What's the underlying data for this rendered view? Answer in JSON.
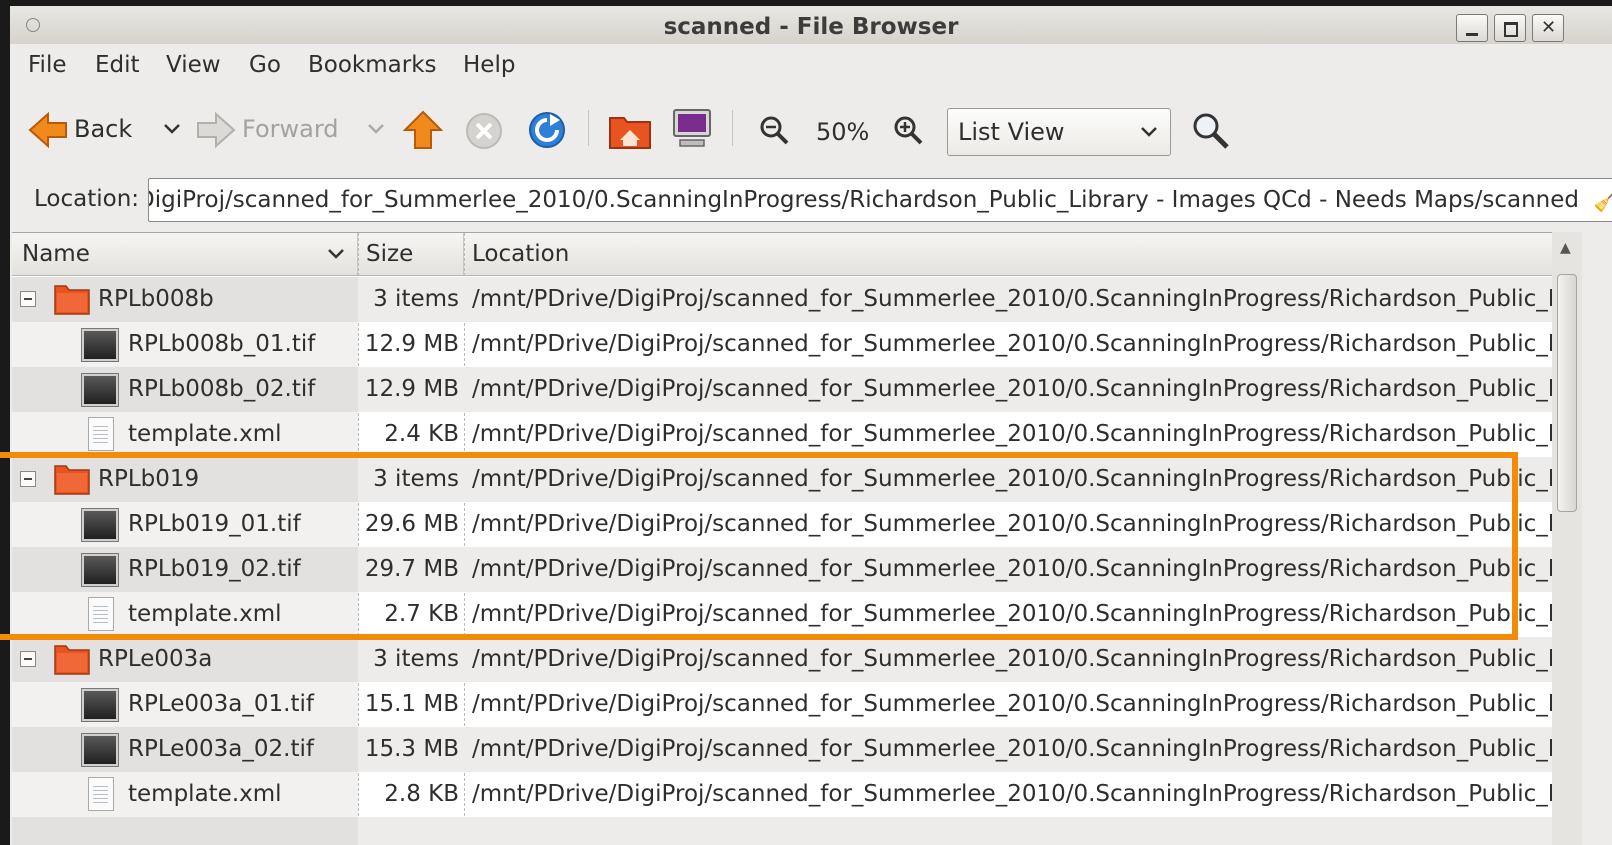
{
  "window": {
    "title": "scanned - File Browser"
  },
  "menu": [
    "File",
    "Edit",
    "View",
    "Go",
    "Bookmarks",
    "Help"
  ],
  "toolbar": {
    "back_label": "Back",
    "forward_label": "Forward",
    "zoom_level": "50%",
    "view_mode": "List View"
  },
  "location": {
    "label": "Location:",
    "path": "/mnt/PDrive/DigiProj/scanned_for_Summerlee_2010/0.ScanningInProgress/Richardson_Public_Library - Images QCd - Needs Maps/scanned"
  },
  "columns": {
    "name": "Name",
    "size": "Size",
    "location": "Location"
  },
  "rows": [
    {
      "type": "folder",
      "name": "RPLb008b",
      "size": "3 items",
      "location": "/mnt/PDrive/DigiProj/scanned_for_Summerlee_2010/0.ScanningInProgress/Richardson_Public_Library"
    },
    {
      "type": "tif",
      "name": "RPLb008b_01.tif",
      "size": "12.9 MB",
      "location": "/mnt/PDrive/DigiProj/scanned_for_Summerlee_2010/0.ScanningInProgress/Richardson_Public_Library"
    },
    {
      "type": "tif",
      "name": "RPLb008b_02.tif",
      "size": "12.9 MB",
      "location": "/mnt/PDrive/DigiProj/scanned_for_Summerlee_2010/0.ScanningInProgress/Richardson_Public_Library"
    },
    {
      "type": "xml",
      "name": "template.xml",
      "size": "2.4 KB",
      "location": "/mnt/PDrive/DigiProj/scanned_for_Summerlee_2010/0.ScanningInProgress/Richardson_Public_Library"
    },
    {
      "type": "folder",
      "name": "RPLb019",
      "size": "3 items",
      "location": "/mnt/PDrive/DigiProj/scanned_for_Summerlee_2010/0.ScanningInProgress/Richardson_Public_Library"
    },
    {
      "type": "tif",
      "name": "RPLb019_01.tif",
      "size": "29.6 MB",
      "location": "/mnt/PDrive/DigiProj/scanned_for_Summerlee_2010/0.ScanningInProgress/Richardson_Public_Library"
    },
    {
      "type": "tif",
      "name": "RPLb019_02.tif",
      "size": "29.7 MB",
      "location": "/mnt/PDrive/DigiProj/scanned_for_Summerlee_2010/0.ScanningInProgress/Richardson_Public_Library"
    },
    {
      "type": "xml",
      "name": "template.xml",
      "size": "2.7 KB",
      "location": "/mnt/PDrive/DigiProj/scanned_for_Summerlee_2010/0.ScanningInProgress/Richardson_Public_Library"
    },
    {
      "type": "folder",
      "name": "RPLe003a",
      "size": "3 items",
      "location": "/mnt/PDrive/DigiProj/scanned_for_Summerlee_2010/0.ScanningInProgress/Richardson_Public_Library"
    },
    {
      "type": "tif",
      "name": "RPLe003a_01.tif",
      "size": "15.1 MB",
      "location": "/mnt/PDrive/DigiProj/scanned_for_Summerlee_2010/0.ScanningInProgress/Richardson_Public_Library"
    },
    {
      "type": "tif",
      "name": "RPLe003a_02.tif",
      "size": "15.3 MB",
      "location": "/mnt/PDrive/DigiProj/scanned_for_Summerlee_2010/0.ScanningInProgress/Richardson_Public_Library"
    },
    {
      "type": "xml",
      "name": "template.xml",
      "size": "2.8 KB",
      "location": "/mnt/PDrive/DigiProj/scanned_for_Summerlee_2010/0.ScanningInProgress/Richardson_Public_Library"
    }
  ],
  "colors": {
    "highlight": "#f28c08",
    "folder": "#e8541f",
    "reload": "#2f7fd6",
    "up_arrow": "#f08a1c"
  },
  "icons": [
    "back-icon",
    "forward-icon",
    "up-icon",
    "stop-icon",
    "reload-icon",
    "home-icon",
    "computer-icon",
    "zoom-out-icon",
    "zoom-in-icon",
    "search-icon",
    "folder-icon",
    "image-file-icon",
    "text-file-icon",
    "clear-location-icon"
  ]
}
